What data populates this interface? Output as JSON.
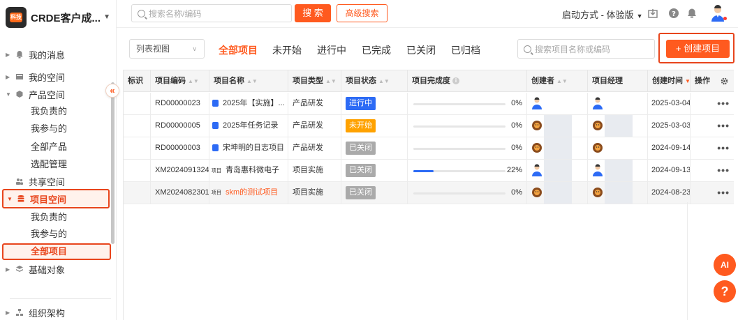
{
  "app": {
    "name": "CRDE客户成...",
    "logo_text": "科技"
  },
  "sidebar": {
    "items": [
      {
        "label": "我的消息",
        "icon": "bell-icon"
      },
      {
        "label": "我的空间",
        "icon": "folder-icon"
      },
      {
        "label": "产品空间",
        "icon": "cube-icon"
      },
      {
        "label": "我负责的"
      },
      {
        "label": "我参与的"
      },
      {
        "label": "全部产品"
      },
      {
        "label": "选配管理"
      },
      {
        "label": "共享空间",
        "icon": "share-icon"
      },
      {
        "label": "项目空间",
        "icon": "database-icon"
      },
      {
        "label": "我负责的"
      },
      {
        "label": "我参与的"
      },
      {
        "label": "全部项目"
      },
      {
        "label": "基础对象",
        "icon": "layers-icon"
      },
      {
        "label": "组织架构",
        "icon": "org-icon"
      }
    ]
  },
  "topbar": {
    "search_placeholder": "搜索名称/编码",
    "search_button": "搜 索",
    "advanced_button": "高级搜索",
    "mode_label": "启动方式 - 体验版"
  },
  "toolbar": {
    "view_select": "列表视图",
    "tabs": [
      "全部项目",
      "未开始",
      "进行中",
      "已完成",
      "已关闭",
      "已归档"
    ],
    "search_placeholder": "搜索项目名称或编码",
    "create_button": "+ 创建项目"
  },
  "table": {
    "headers": [
      "标识",
      "项目编码",
      "项目名称",
      "项目类型",
      "项目状态",
      "项目完成度",
      "创建者",
      "项目经理",
      "创建时间",
      "操作"
    ],
    "rows": [
      {
        "code": "RD00000023",
        "name": "2025年【实施】...",
        "type": "产品研发",
        "status": "进行中",
        "status_kind": "run",
        "progress": 0,
        "progress_label": "0%",
        "created": "2025-03-04"
      },
      {
        "code": "RD00000005",
        "name": "2025年任务记录",
        "type": "产品研发",
        "status": "未开始",
        "status_kind": "wait",
        "progress": 0,
        "progress_label": "0%",
        "created": "2025-03-03"
      },
      {
        "code": "RD00000003",
        "name": "宋坤明的日志项目",
        "type": "产品研发",
        "status": "已关闭",
        "status_kind": "closed",
        "progress": 0,
        "progress_label": "0%",
        "created": "2024-09-14"
      },
      {
        "code": "XM2024091324",
        "name": "青岛惠科微电子",
        "type": "项目实施",
        "status": "已关闭",
        "status_kind": "closed",
        "progress": 22,
        "progress_label": "22%",
        "created": "2024-09-13"
      },
      {
        "code": "XM2024082301",
        "name": "skm的测试项目",
        "type": "项目实施",
        "status": "已关闭",
        "status_kind": "closed",
        "progress": 0,
        "progress_label": "0%",
        "created": "2024-08-23"
      }
    ],
    "name_tag": "项目",
    "more": "•••"
  },
  "floats": {
    "ai_label": "AI",
    "help_label": "?"
  },
  "colors": {
    "accent": "#ff5a1f",
    "highlight_border": "#e8451c",
    "status_run": "#2d6bf5",
    "status_wait": "#ffa200",
    "status_closed": "#aaaaaa"
  }
}
